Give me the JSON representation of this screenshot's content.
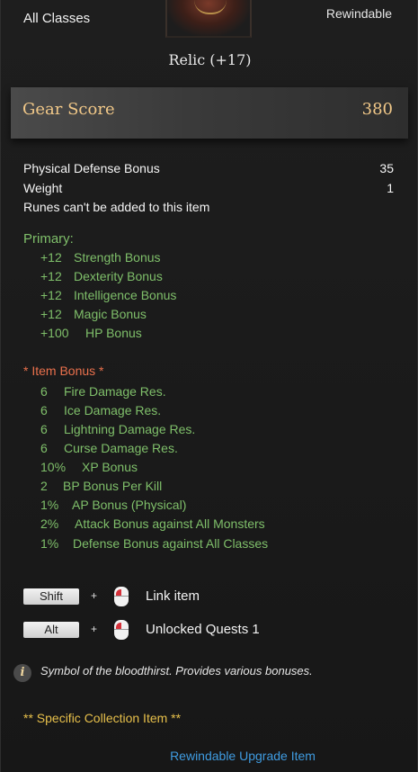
{
  "header": {
    "class_restriction": "All Classes",
    "rewindable": "Rewindable",
    "item_name": "Relic (+17)"
  },
  "gear_score": {
    "label": "Gear Score",
    "value": "380"
  },
  "stats": [
    {
      "label": "Physical Defense Bonus",
      "value": "35"
    },
    {
      "label": "Weight",
      "value": "1"
    }
  ],
  "runes_note": "Runes can't be added to this item",
  "primary": {
    "title": "Primary:",
    "items": [
      {
        "value": "+12",
        "label": "Strength Bonus"
      },
      {
        "value": "+12",
        "label": "Dexterity Bonus"
      },
      {
        "value": "+12",
        "label": "Intelligence Bonus"
      },
      {
        "value": "+12",
        "label": "Magic Bonus"
      },
      {
        "value": "+100",
        "label": "HP Bonus"
      }
    ]
  },
  "item_bonus": {
    "title": "*  Item Bonus *",
    "items": [
      {
        "value": "6",
        "label": "Fire Damage Res."
      },
      {
        "value": "6",
        "label": "Ice Damage Res."
      },
      {
        "value": "6",
        "label": "Lightning Damage Res."
      },
      {
        "value": "6",
        "label": "Curse Damage Res."
      },
      {
        "value": "10%",
        "label": "XP Bonus"
      },
      {
        "value": "2",
        "label": "BP Bonus Per Kill"
      },
      {
        "value": "1%",
        "label": "AP Bonus (Physical)"
      },
      {
        "value": "2%",
        "label": "Attack Bonus against All Monsters"
      },
      {
        "value": "1%",
        "label": "Defense Bonus against All Classes"
      }
    ]
  },
  "actions": [
    {
      "key": "Shift",
      "plus": "+",
      "label": "Link item"
    },
    {
      "key": "Alt",
      "plus": "+",
      "label": "Unlocked Quests 1"
    }
  ],
  "description": "Symbol of the bloodthirst. Provides various bonuses.",
  "info_icon": "i",
  "collection": "** Specific Collection Item **",
  "footer": "Rewindable Upgrade Item",
  "colors": {
    "gear_score": "#f1c888",
    "bonus_green": "#7fbf6a",
    "item_bonus_title": "#e9704c",
    "collection_gold": "#e7c04b",
    "footer_blue": "#3f9be0"
  }
}
